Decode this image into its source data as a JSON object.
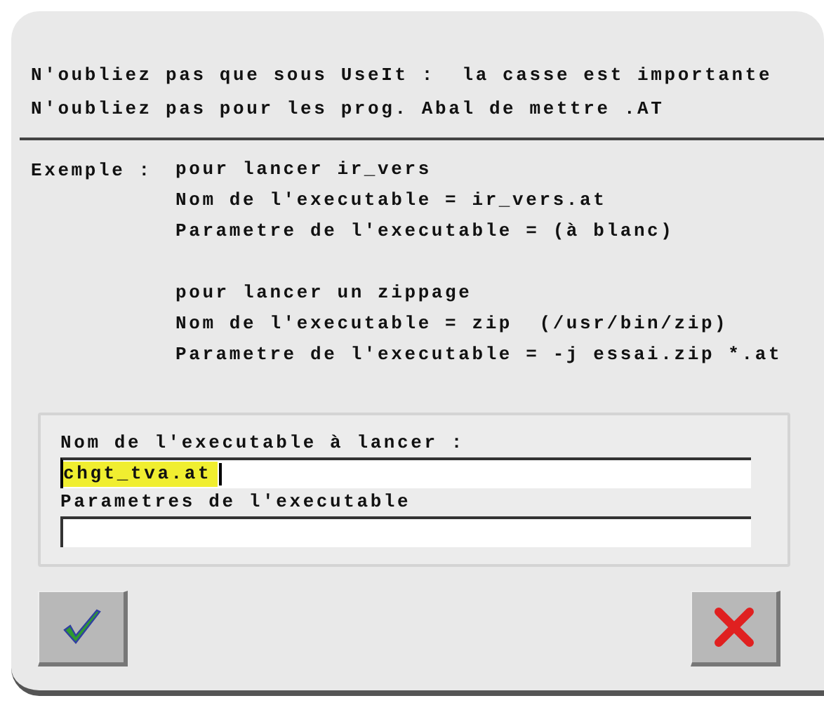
{
  "notices": [
    "N'oubliez pas que sous UseIt :  la casse est importante",
    "N'oubliez pas pour les prog. Abal de mettre .AT"
  ],
  "example": {
    "label": "Exemple :",
    "groups": [
      {
        "lines": [
          "pour lancer ir_vers",
          "Nom de l'executable = ir_vers.at",
          "Parametre de l'executable = (à blanc)"
        ]
      },
      {
        "lines": [
          "pour lancer un zippage",
          "Nom de l'executable = zip  (/usr/bin/zip)",
          "Parametre de l'executable = -j essai.zip *.at"
        ]
      }
    ]
  },
  "fields": [
    {
      "label": "Nom de l'executable à lancer :",
      "value": "chgt_tva.at",
      "highlighted": true,
      "focused": true
    },
    {
      "label": "Parametres de l'executable",
      "focused": false
    }
  ],
  "buttons": [
    {
      "kind": "ok"
    },
    {
      "kind": "cancel"
    }
  ]
}
